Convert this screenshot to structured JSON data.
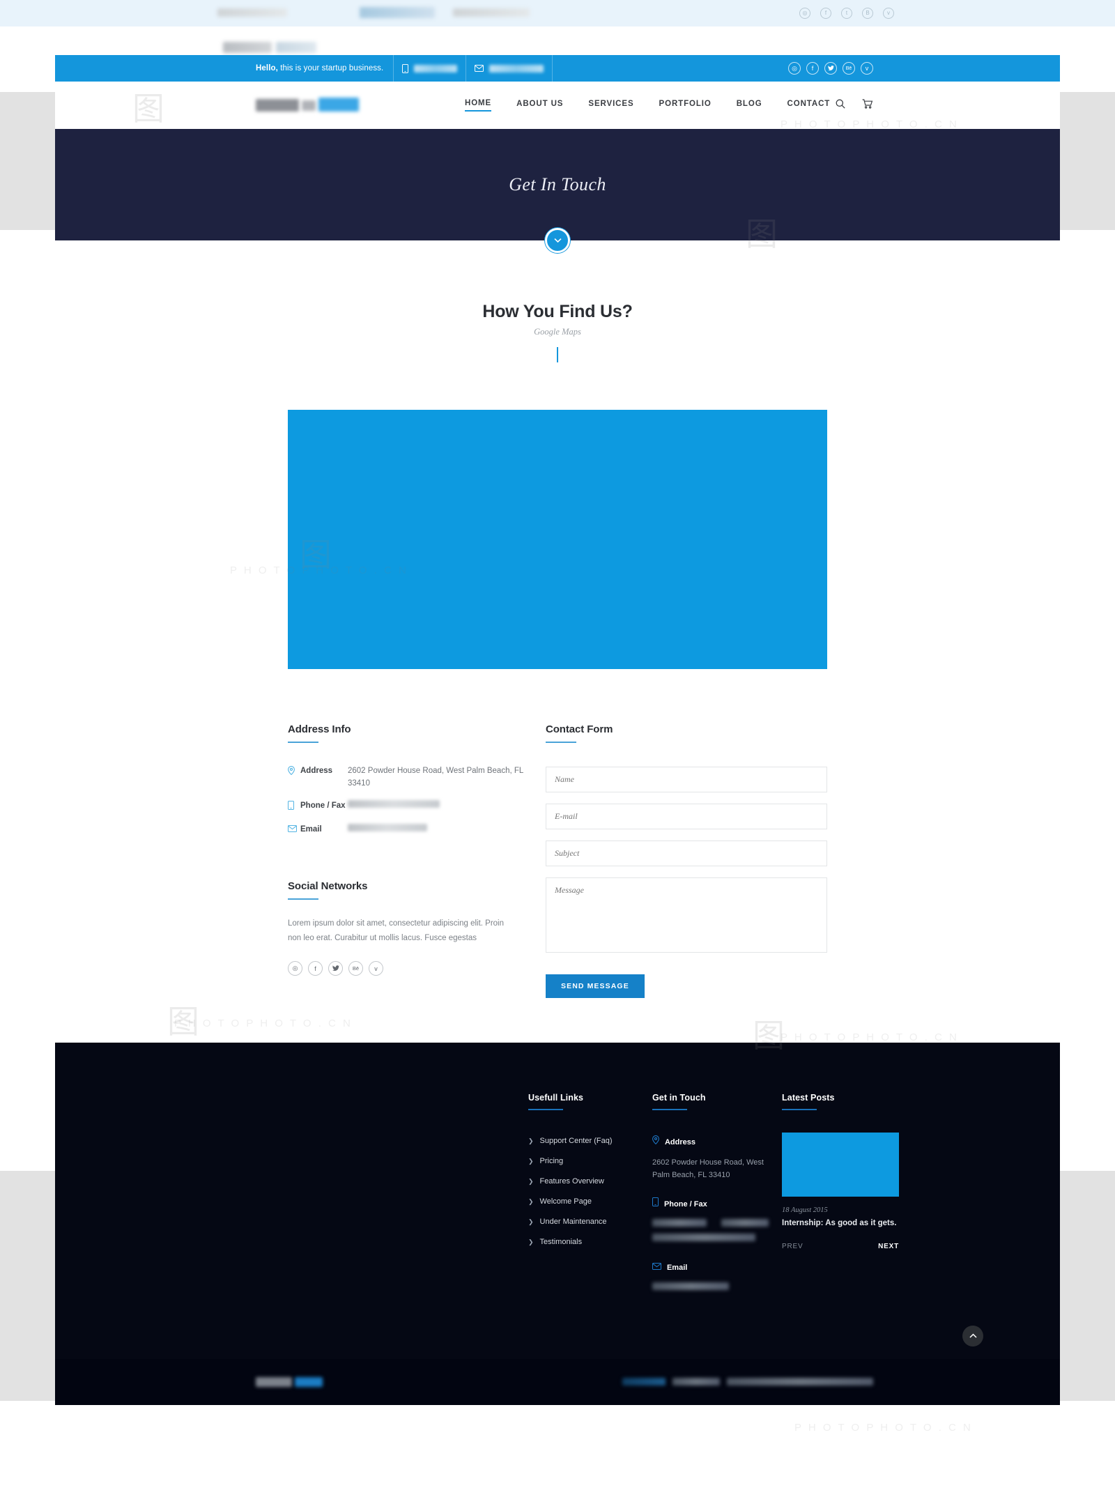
{
  "topbar": {
    "hello_strong": "Hello,",
    "hello_text": " this is your startup business.",
    "phone_icon": "phone-icon",
    "email_icon": "envelope-icon",
    "social": [
      {
        "name": "dribbble-icon",
        "glyph": "◎"
      },
      {
        "name": "facebook-icon",
        "glyph": "f"
      },
      {
        "name": "twitter-icon",
        "glyph": "🐦"
      },
      {
        "name": "behance-icon",
        "glyph": "Bē"
      },
      {
        "name": "vimeo-icon",
        "glyph": "v"
      }
    ]
  },
  "header": {
    "nav": [
      {
        "label": "HOME",
        "active": true
      },
      {
        "label": "ABOUT US",
        "active": false
      },
      {
        "label": "SERVICES",
        "active": false
      },
      {
        "label": "PORTFOLIO",
        "active": false
      },
      {
        "label": "BLOG",
        "active": false
      },
      {
        "label": "CONTACT",
        "active": false
      }
    ],
    "search_icon": "search-icon",
    "cart_icon": "cart-icon"
  },
  "hero": {
    "title": "Get In Touch",
    "scroll_icon": "chevron-down-icon"
  },
  "section": {
    "title": "How You Find Us?",
    "subtitle": "Google Maps",
    "map_color": "#0d9ae0"
  },
  "address_info": {
    "title": "Address Info",
    "rows": [
      {
        "icon": "map-pin-icon",
        "label": "Address",
        "value": "2602 Powder House Road, West Palm Beach, FL 33410",
        "redacted": false
      },
      {
        "icon": "phone-icon",
        "label": "Phone / Fax",
        "value": "",
        "redacted": true
      },
      {
        "icon": "envelope-icon",
        "label": "Email",
        "value": "",
        "redacted": true
      }
    ]
  },
  "social_networks": {
    "title": "Social Networks",
    "description": "Lorem ipsum dolor sit amet, consectetur adipiscing elit. Proin non leo erat. Curabitur ut mollis lacus. Fusce egestas",
    "icons": [
      {
        "name": "dribbble-icon",
        "glyph": "◎"
      },
      {
        "name": "facebook-icon",
        "glyph": "f"
      },
      {
        "name": "twitter-icon",
        "glyph": "🐦"
      },
      {
        "name": "behance-icon",
        "glyph": "Bē"
      },
      {
        "name": "vimeo-icon",
        "glyph": "v"
      }
    ]
  },
  "contact_form": {
    "title": "Contact Form",
    "name_placeholder": "Name",
    "email_placeholder": "E-mail",
    "subject_placeholder": "Subject",
    "message_placeholder": "Message",
    "name_value": "",
    "email_value": "",
    "subject_value": "",
    "message_value": "",
    "submit_label": "SEND MESSAGE"
  },
  "footer": {
    "useful_links": {
      "title": "Usefull Links",
      "items": [
        {
          "label": "Support Center (Faq)"
        },
        {
          "label": "Pricing"
        },
        {
          "label": "Features Overview"
        },
        {
          "label": "Welcome Page"
        },
        {
          "label": "Under Maintenance"
        },
        {
          "label": "Testimonials"
        }
      ]
    },
    "get_in_touch": {
      "title": "Get in Touch",
      "address_label": "Address",
      "address_value": "2602 Powder House Road, West Palm Beach, FL 33410",
      "phone_label": "Phone / Fax",
      "phone_value": "",
      "email_label": "Email",
      "email_value": ""
    },
    "latest_posts": {
      "title": "Latest Posts",
      "post_date": "18 August 2015",
      "post_title": "Internship: As good as it gets.",
      "prev_label": "PREV",
      "next_label": "NEXT",
      "thumb_color": "#0d9ae0"
    },
    "back_to_top_icon": "chevron-up-icon"
  },
  "colors": {
    "accent": "#1496dc",
    "hero_bg": "#1e2240",
    "footer_bg": "#050814",
    "button": "#1581c8"
  },
  "watermarks": {
    "text": "PHOTOPHOTO.CN"
  }
}
